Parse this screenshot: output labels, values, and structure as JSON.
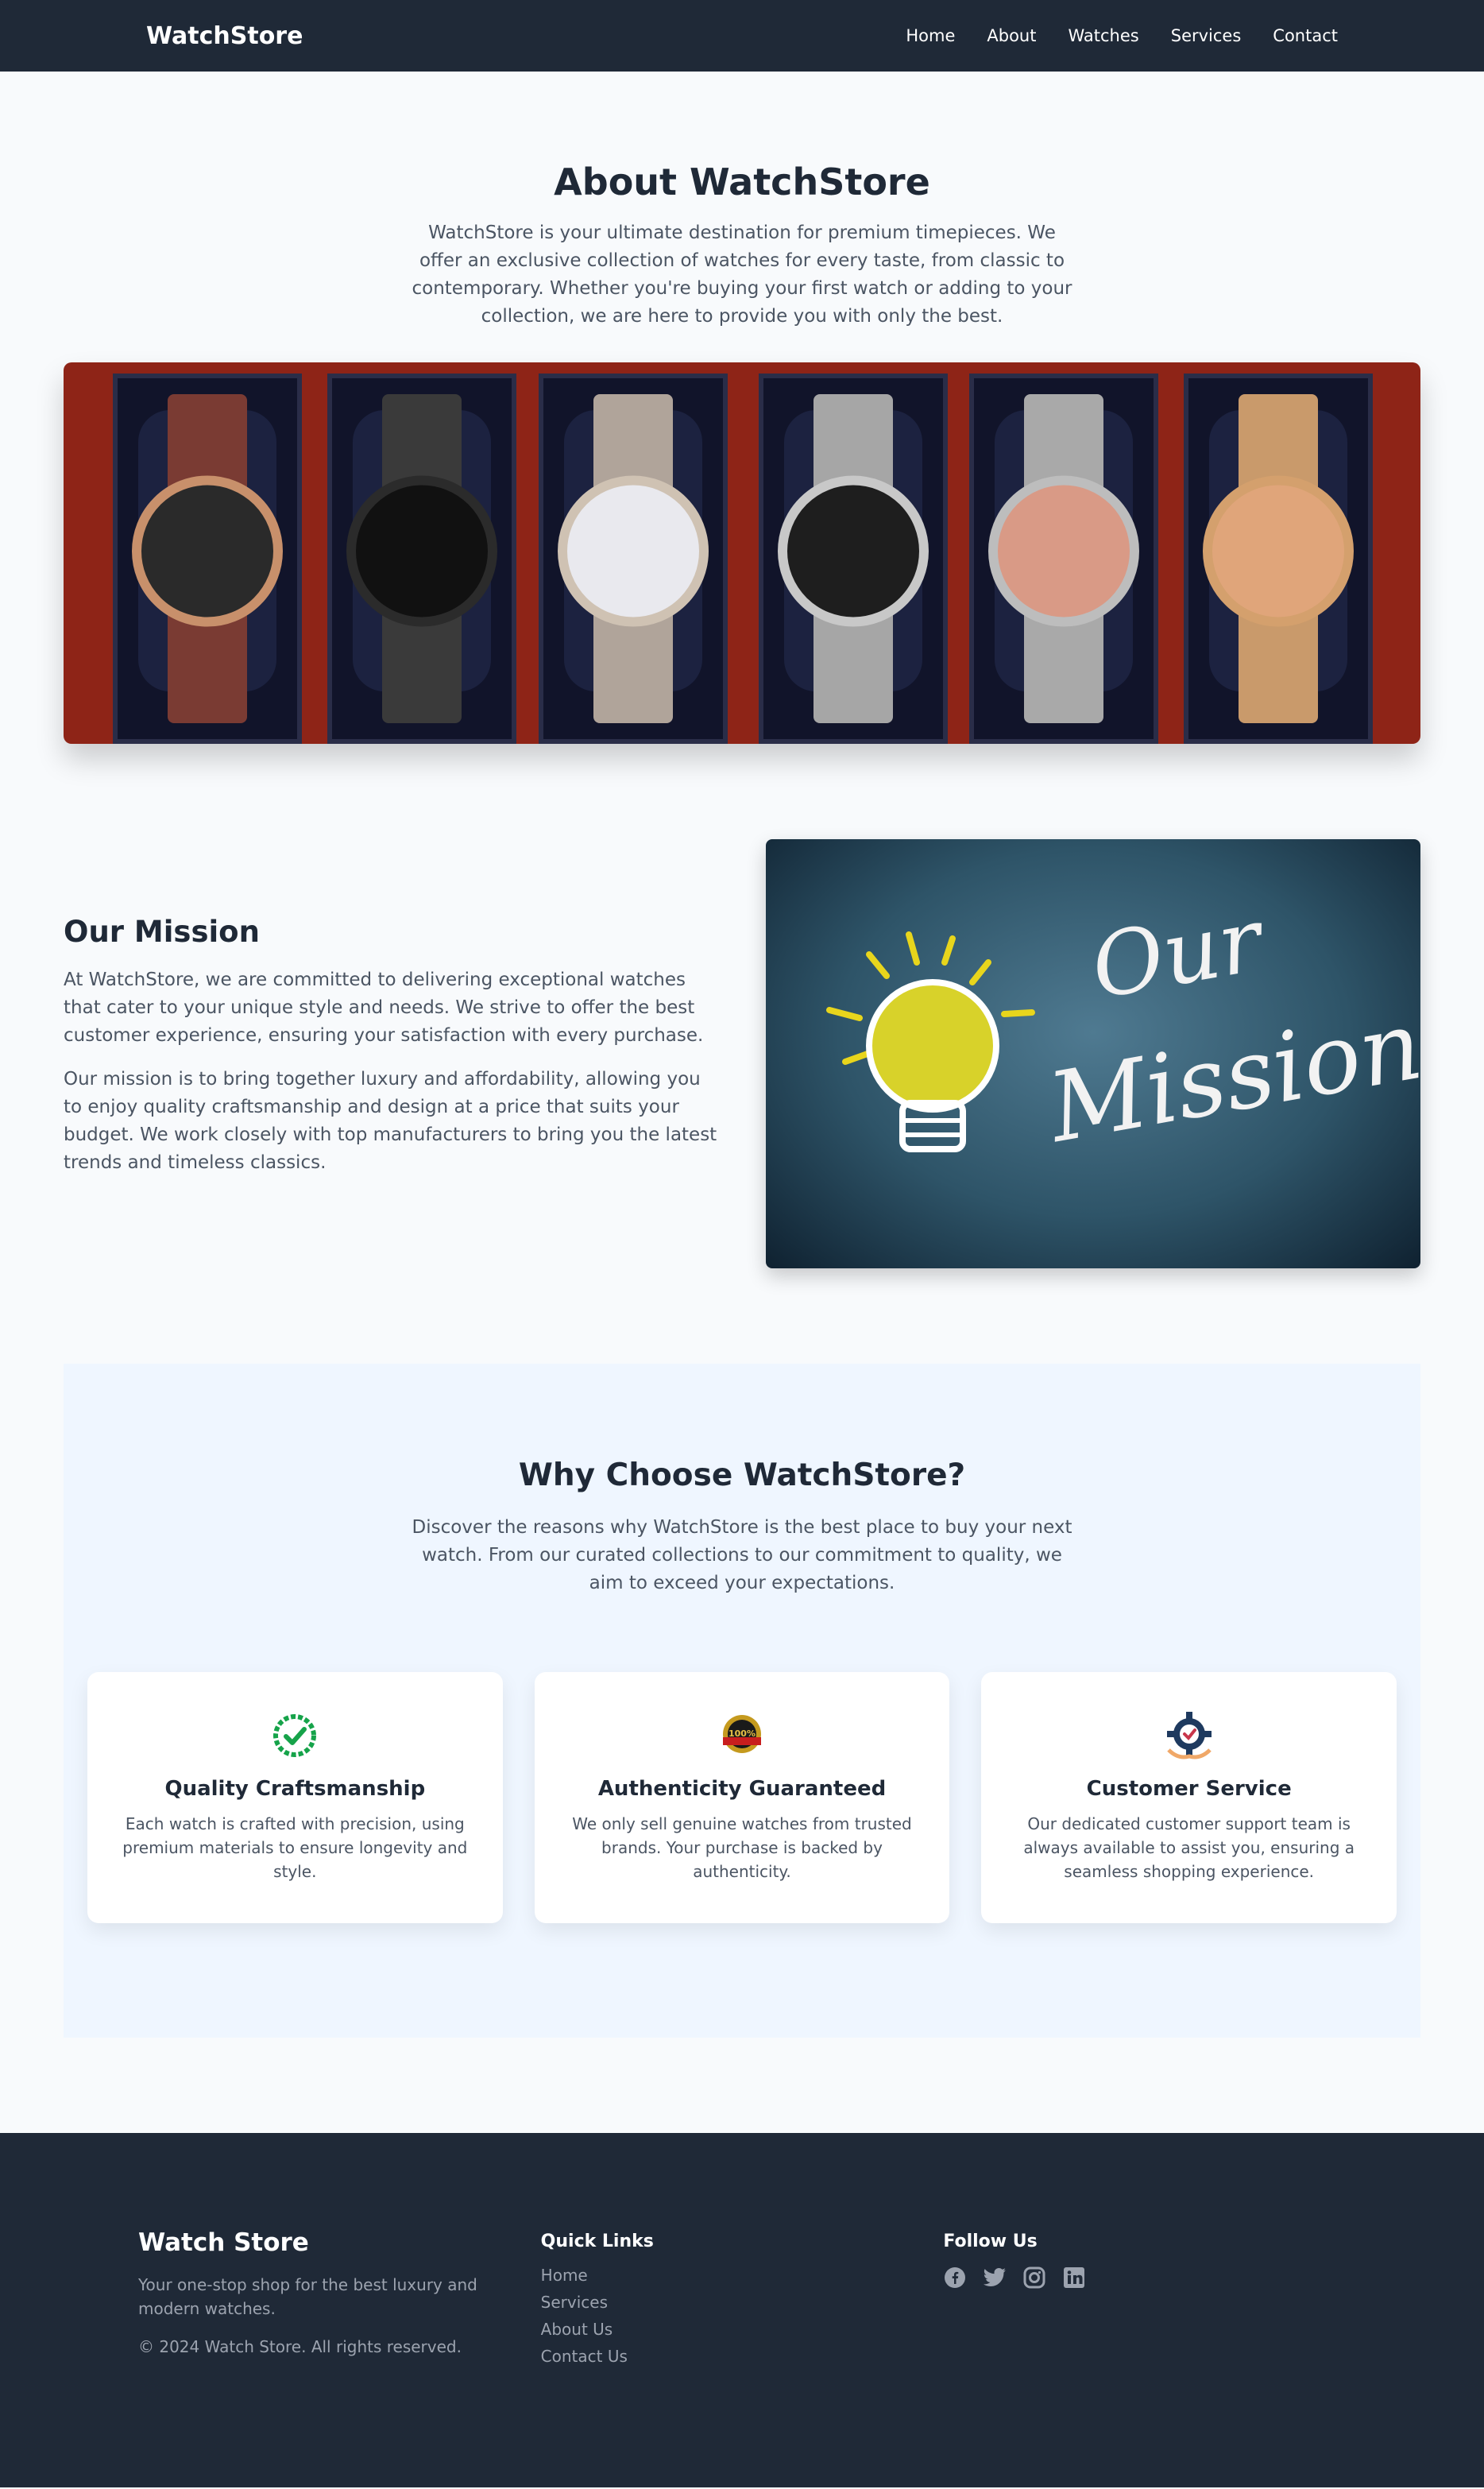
{
  "nav": {
    "brand": "WatchStore",
    "links": [
      "Home",
      "About",
      "Watches",
      "Services",
      "Contact"
    ]
  },
  "about": {
    "title": "About WatchStore",
    "text": "WatchStore is your ultimate destination for premium timepieces. We offer an exclusive collection of watches for every taste, from classic to contemporary. Whether you're buying your first watch or adding to your collection, we are here to provide you with only the best."
  },
  "mission": {
    "title": "Our Mission",
    "p1": "At WatchStore, we are committed to delivering exceptional watches that cater to your unique style and needs. We strive to offer the best customer experience, ensuring your satisfaction with every purchase.",
    "p2": "Our mission is to bring together luxury and affordability, allowing you to enjoy quality craftsmanship and design at a price that suits your budget. We work closely with top manufacturers to bring you the latest trends and timeless classics.",
    "image_text_1": "Our",
    "image_text_2": "Mission"
  },
  "why": {
    "title": "Why Choose WatchStore?",
    "lead": "Discover the reasons why WatchStore is the best place to buy your next watch. From our curated collections to our commitment to quality, we aim to exceed your expectations.",
    "cards": [
      {
        "icon": "check-badge-icon",
        "title": "Quality Craftsmanship",
        "text": "Each watch is crafted with precision, using premium materials to ensure longevity and style."
      },
      {
        "icon": "guarantee-seal-icon",
        "title": "Authenticity Guaranteed",
        "text": "We only sell genuine watches from trusted brands. Your purchase is backed by authenticity."
      },
      {
        "icon": "customer-service-gear-icon",
        "title": "Customer Service",
        "text": "Our dedicated customer support team is always available to assist you, ensuring a seamless shopping experience."
      }
    ],
    "seal_text": "100%"
  },
  "footer": {
    "brand": "Watch Store",
    "tagline": "Your one-stop shop for the best luxury and modern watches.",
    "copyright": "© 2024 Watch Store. All rights reserved.",
    "quick_links_title": "Quick Links",
    "quick_links": [
      "Home",
      "Services",
      "About Us",
      "Contact Us"
    ],
    "follow_title": "Follow Us",
    "social": [
      "facebook-icon",
      "twitter-icon",
      "instagram-icon",
      "linkedin-icon"
    ]
  },
  "colors": {
    "nav_bg": "#1f2937",
    "why_bg": "#eff6ff",
    "check_green": "#16a34a",
    "gear_blue": "#1e3a5f"
  }
}
